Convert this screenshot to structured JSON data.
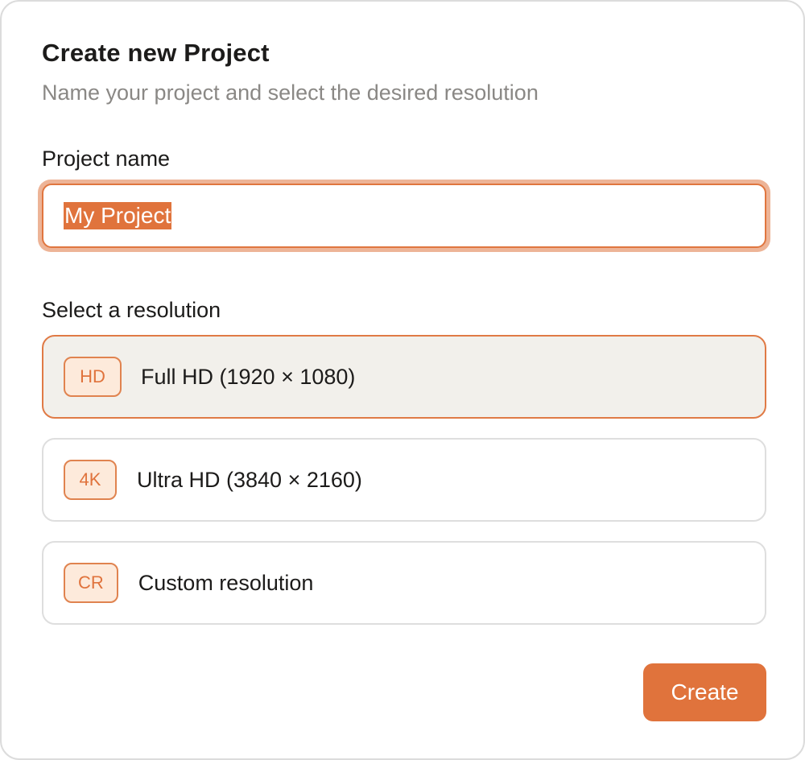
{
  "dialog": {
    "title": "Create new Project",
    "subtitle": "Name your project and select the desired resolution"
  },
  "project_name": {
    "label": "Project name",
    "value": "My Project",
    "text_selected": true
  },
  "resolution": {
    "label": "Select a resolution",
    "selected_index": 0,
    "options": [
      {
        "badge": "HD",
        "label": "Full HD (1920 × 1080)"
      },
      {
        "badge": "4K",
        "label": "Ultra HD (3840 × 2160)"
      },
      {
        "badge": "CR",
        "label": "Custom resolution"
      }
    ]
  },
  "actions": {
    "create_label": "Create"
  },
  "colors": {
    "accent": "#e0733c",
    "focus_ring": "#edb497",
    "badge_bg": "#fdeadb",
    "selected_bg": "#f2f0eb",
    "border": "#dedede",
    "muted_text": "#8a8885"
  }
}
